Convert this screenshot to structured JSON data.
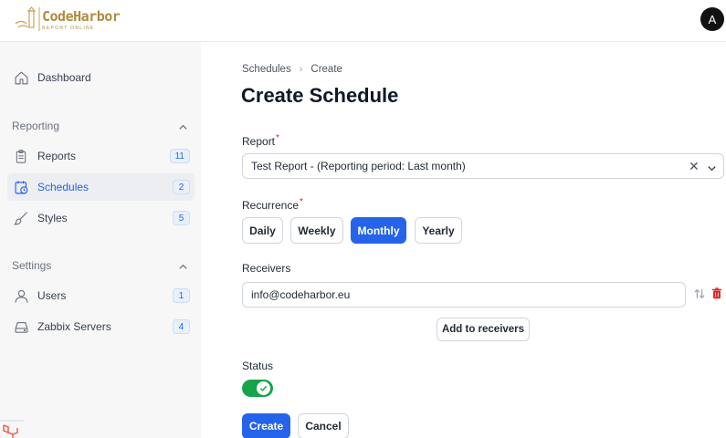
{
  "header": {
    "brand_name": "CodeHarbor",
    "brand_tagline": "REPORT ONLINE",
    "avatar_initial": "A"
  },
  "sidebar": {
    "dashboard": {
      "label": "Dashboard",
      "icon": "home-icon"
    },
    "sections": [
      {
        "title": "Reporting",
        "items": [
          {
            "label": "Reports",
            "count": "11",
            "icon": "clipboard-icon"
          },
          {
            "label": "Schedules",
            "count": "2",
            "icon": "calendar-clock-icon",
            "active": true
          },
          {
            "label": "Styles",
            "count": "5",
            "icon": "brush-icon"
          }
        ]
      },
      {
        "title": "Settings",
        "items": [
          {
            "label": "Users",
            "count": "1",
            "icon": "user-icon"
          },
          {
            "label": "Zabbix Servers",
            "count": "4",
            "icon": "server-icon"
          }
        ]
      }
    ]
  },
  "breadcrumb": {
    "parent": "Schedules",
    "current": "Create"
  },
  "page_title": "Create Schedule",
  "form": {
    "report": {
      "label": "Report",
      "required": true,
      "value": "Test Report - (Reporting period: Last month)"
    },
    "recurrence": {
      "label": "Recurrence",
      "required": true,
      "options": [
        "Daily",
        "Weekly",
        "Monthly",
        "Yearly"
      ],
      "selected": "Monthly"
    },
    "receivers": {
      "label": "Receivers",
      "value": "info@codeharbor.eu",
      "add_label": "Add to receivers"
    },
    "status": {
      "label": "Status",
      "enabled": true
    },
    "submit_label": "Create",
    "cancel_label": "Cancel"
  },
  "colors": {
    "accent": "#2563eb",
    "toggle_on": "#16a34a",
    "danger": "#dc2626",
    "brand": "#b08a3e"
  }
}
